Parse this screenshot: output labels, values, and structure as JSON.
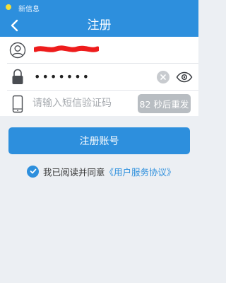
{
  "status_bar": {
    "text": "新信息"
  },
  "nav": {
    "title": "注册",
    "back_icon": "chevron-left-icon"
  },
  "form": {
    "username": {
      "icon": "user-icon",
      "value_redacted": true
    },
    "password": {
      "icon": "lock-icon",
      "masked_value": "•••••••",
      "clear_icon": "clear-icon",
      "toggle_icon": "eye-icon"
    },
    "sms_code": {
      "icon": "phone-icon",
      "placeholder": "请输入短信验证码",
      "resend_label": "82 秒后重发"
    }
  },
  "register_button": {
    "label": "注册账号"
  },
  "agreement": {
    "checked": true,
    "text": "我已阅读并同意",
    "link_text": "《用户服务协议》"
  },
  "colors": {
    "primary": "#2d8fdd",
    "background": "#eceff3",
    "disabled": "#b8bdc2"
  }
}
